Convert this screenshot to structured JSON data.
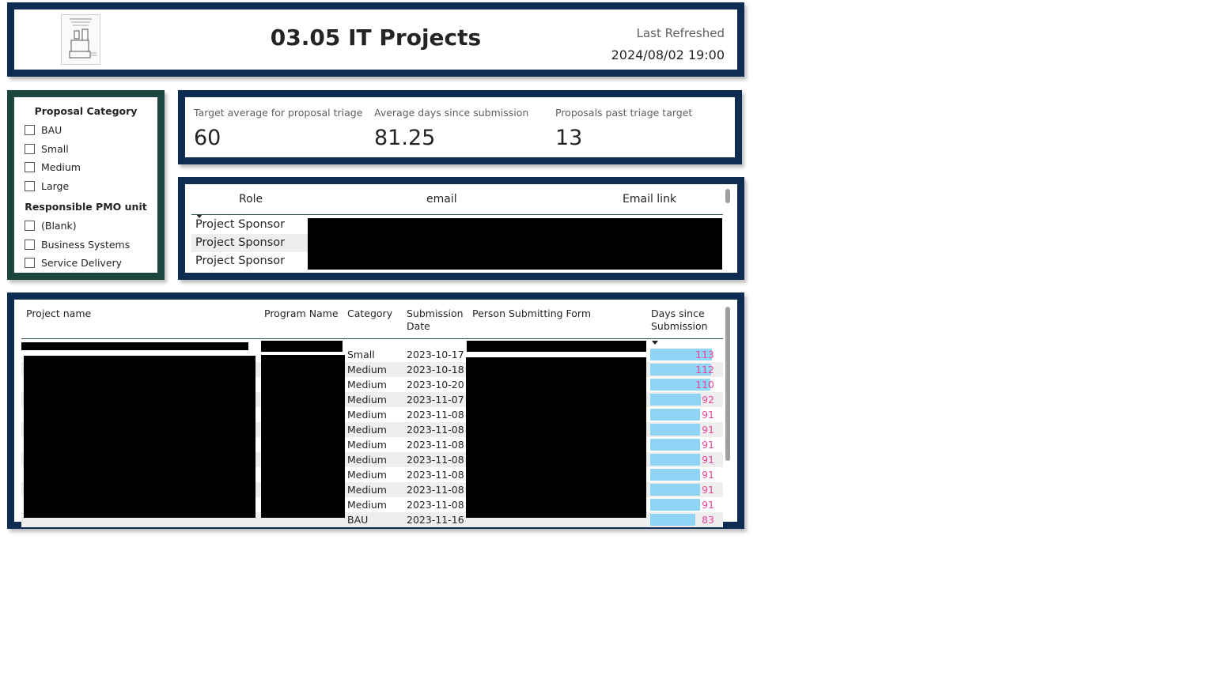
{
  "header": {
    "title": "03.05 IT Projects",
    "refresh_label": "Last Refreshed",
    "refresh_value": "2024/08/02 19:00"
  },
  "slicer": {
    "category_title": "Proposal Category",
    "categories": [
      "BAU",
      "Small",
      "Medium",
      "Large"
    ],
    "pmo_title": "Responsible PMO unit",
    "pmo_units": [
      "(Blank)",
      "Business Systems",
      "Service Delivery"
    ]
  },
  "kpi": {
    "items": [
      {
        "label": "Target average for proposal triage",
        "value": "60"
      },
      {
        "label": "Average days since submission",
        "value": "81.25"
      },
      {
        "label": "Proposals past triage target",
        "value": "13"
      }
    ]
  },
  "roles": {
    "headers": [
      "Role",
      "email",
      "Email link"
    ],
    "rows": [
      "Project Sponsor",
      "Project Sponsor",
      "Project Sponsor"
    ]
  },
  "projects": {
    "headers": {
      "project_name": "Project name",
      "program_name": "Program Name",
      "category": "Category",
      "submission_date_1": "Submission",
      "submission_date_2": "Date",
      "person": "Person Submitting Form",
      "days_1": "Days since",
      "days_2": "Submission"
    },
    "rows": [
      {
        "category": "Small",
        "date": "2023-10-17",
        "days": 113
      },
      {
        "category": "Medium",
        "date": "2023-10-18",
        "days": 112
      },
      {
        "category": "Medium",
        "date": "2023-10-20",
        "days": 110
      },
      {
        "category": "Medium",
        "date": "2023-11-07",
        "days": 92
      },
      {
        "category": "Medium",
        "date": "2023-11-08",
        "days": 91
      },
      {
        "category": "Medium",
        "date": "2023-11-08",
        "days": 91
      },
      {
        "category": "Medium",
        "date": "2023-11-08",
        "days": 91
      },
      {
        "category": "Medium",
        "date": "2023-11-08",
        "days": 91
      },
      {
        "category": "Medium",
        "date": "2023-11-08",
        "days": 91
      },
      {
        "category": "Medium",
        "date": "2023-11-08",
        "days": 91
      },
      {
        "category": "Medium",
        "date": "2023-11-08",
        "days": 91
      },
      {
        "category": "BAU",
        "date": "2023-11-16",
        "days": 83
      }
    ],
    "days_max": 113
  },
  "colors": {
    "navy_border": "#0f2d52",
    "green_border": "#1d4641",
    "bar": "#8fd3f5",
    "bar_text": "#e6489b"
  }
}
